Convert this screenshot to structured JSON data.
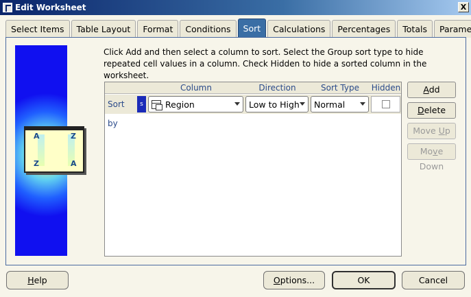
{
  "window": {
    "title": "Edit Worksheet",
    "close_label": "X"
  },
  "tabs": [
    {
      "label": "Select Items"
    },
    {
      "label": "Table Layout"
    },
    {
      "label": "Format"
    },
    {
      "label": "Conditions"
    },
    {
      "label": "Sort"
    },
    {
      "label": "Calculations"
    },
    {
      "label": "Percentages"
    },
    {
      "label": "Totals"
    },
    {
      "label": "Parameters"
    }
  ],
  "active_tab": "Sort",
  "illustration": {
    "letters": [
      "A",
      "Z",
      "Z",
      "A"
    ]
  },
  "instructions": "Click Add and then select a column to sort. Select the Group sort type to hide repeated cell values in a column. Check Hidden to hide a sorted column in the worksheet.",
  "grid": {
    "headers": {
      "column": "Column",
      "direction": "Direction",
      "sort_type": "Sort Type",
      "hidden": "Hidden"
    },
    "rows": [
      {
        "label": "Sort by",
        "marker": "s",
        "column": "Region",
        "direction": "Low to High",
        "sort_type": "Normal",
        "hidden": false
      }
    ]
  },
  "side_buttons": {
    "add": {
      "pre": "",
      "key": "A",
      "post": "dd"
    },
    "delete": {
      "pre": "",
      "key": "D",
      "post": "elete"
    },
    "move_up": {
      "pre": "Move ",
      "key": "U",
      "post": "p"
    },
    "move_down": {
      "pre": "Mo",
      "key": "v",
      "post": "e Down"
    }
  },
  "bottom_buttons": {
    "help": {
      "pre": "",
      "key": "H",
      "post": "elp"
    },
    "options": {
      "pre": "",
      "key": "O",
      "post": "ptions..."
    },
    "ok": "OK",
    "cancel": "Cancel"
  }
}
